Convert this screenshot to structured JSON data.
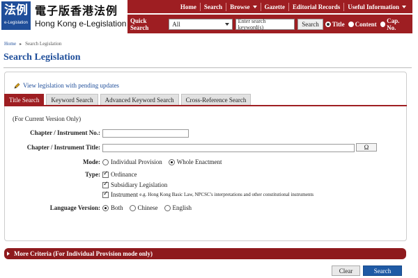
{
  "brand": {
    "logo_chinese": "法例",
    "logo_english": "e-Legislation",
    "title_chinese": "電子版香港法例",
    "title_english": "Hong Kong e-Legislation"
  },
  "topnav": {
    "items": [
      "Home",
      "Search",
      "Browse",
      "Gazette",
      "Editorial Records",
      "Useful Information"
    ]
  },
  "quick_search": {
    "label": "Quick Search",
    "scope_value": "All",
    "placeholder": "Enter search keyword(s)",
    "button": "Search",
    "radios": [
      "Title",
      "Content",
      "Cap. No."
    ],
    "selected_radio": "Title"
  },
  "breadcrumb": {
    "home": "Home",
    "current": "Search Legislation"
  },
  "page_title": "Search Legislation",
  "pending_link": "View legislation with pending updates",
  "tabs": [
    "Title Search",
    "Keyword Search",
    "Advanced Keyword Search",
    "Cross-Reference Search"
  ],
  "active_tab": "Title Search",
  "form": {
    "note": "(For Current Version Only)",
    "chapter_label": "Chapter / Instrument No.:",
    "chapter_value": "",
    "title_label": "Chapter / Instrument Title:",
    "title_value": "",
    "omega_button": "Ω",
    "mode_label": "Mode:",
    "mode_options": [
      "Individual Provision",
      "Whole Enactment"
    ],
    "mode_selected": "Whole Enactment",
    "type_label": "Type:",
    "type_ordinance": "Ordinance",
    "type_subsidiary": "Subsidiary Legislation",
    "type_instrument": "Instrument",
    "type_instrument_note": "e.g. Hong Kong Basic Law, NPCSC's interpretations and other constitutional instruments",
    "language_label": "Language Version:",
    "language_options": [
      "Both",
      "Chinese",
      "English"
    ],
    "language_selected": "Both"
  },
  "more_criteria": "More Criteria (For Individual Provision mode only)",
  "buttons": {
    "clear": "Clear",
    "search": "Search"
  },
  "colors": {
    "brand_red": "#9e1e22",
    "link_blue": "#1f4e9a",
    "search_blue": "#1f5aa5"
  }
}
